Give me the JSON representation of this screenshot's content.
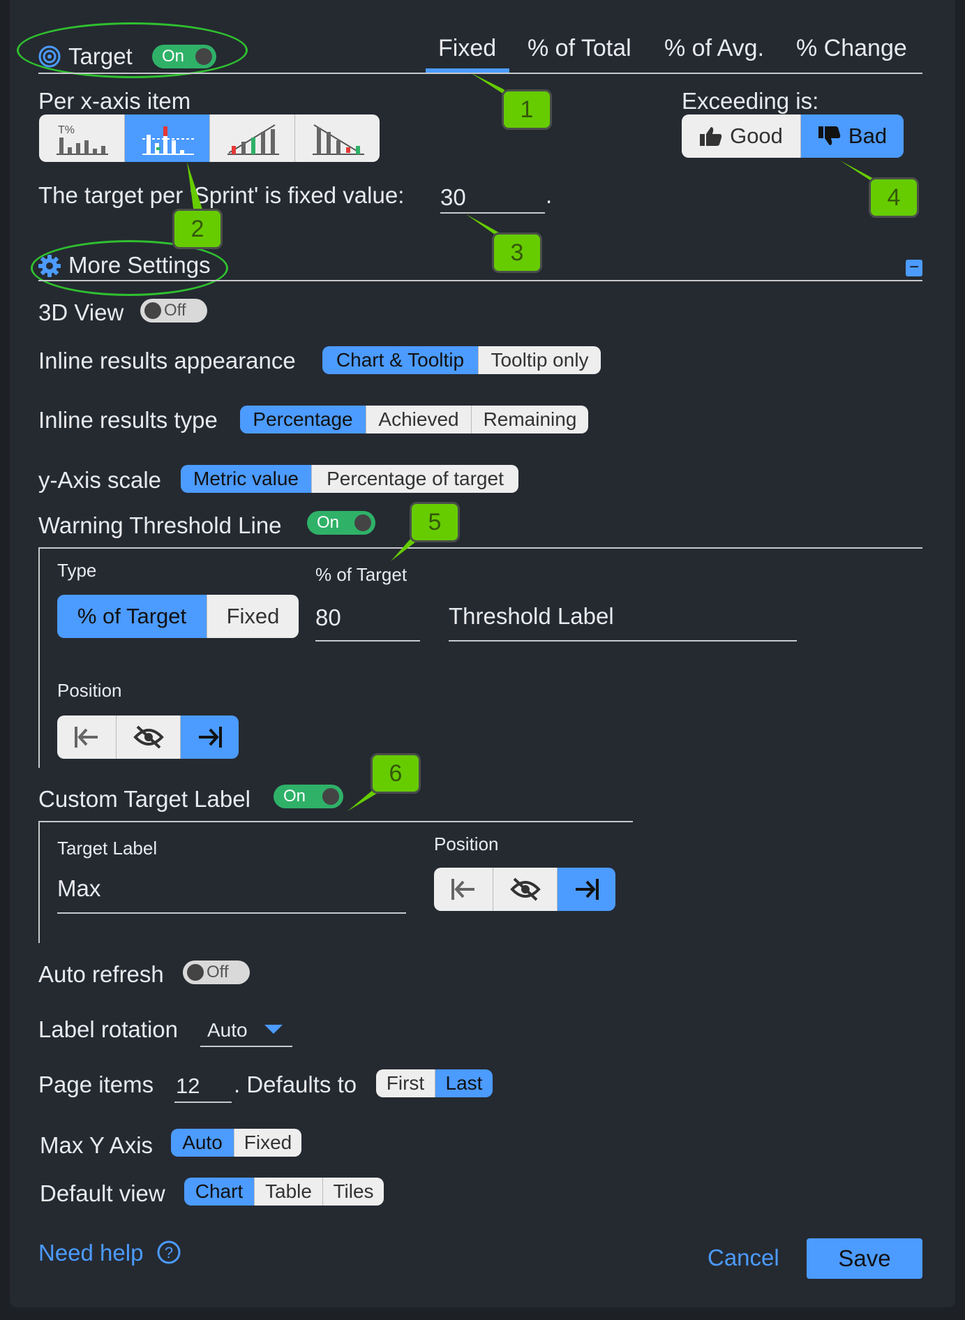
{
  "target": {
    "label": "Target",
    "toggle": "On",
    "tabs": [
      "Fixed",
      "% of Total",
      "% of Avg.",
      "% Change"
    ],
    "active_tab": "Fixed"
  },
  "per_item": {
    "label": "Per x-axis item"
  },
  "exceeding": {
    "label": "Exceeding is:",
    "good": "Good",
    "bad": "Bad",
    "selected": "Bad"
  },
  "target_sentence": {
    "text": "The target per 'Sprint' is fixed value:",
    "value": "30",
    "suffix": "."
  },
  "more_settings": {
    "label": "More Settings",
    "collapse": "−"
  },
  "view3d": {
    "label": "3D View",
    "toggle": "Off"
  },
  "inline_appearance": {
    "label": "Inline results appearance",
    "options": [
      "Chart & Tooltip",
      "Tooltip only"
    ],
    "selected": "Chart & Tooltip"
  },
  "inline_type": {
    "label": "Inline results type",
    "options": [
      "Percentage",
      "Achieved",
      "Remaining"
    ],
    "selected": "Percentage"
  },
  "y_scale": {
    "label": "y-Axis scale",
    "options": [
      "Metric value",
      "Percentage of target"
    ],
    "selected": "Metric value"
  },
  "warning": {
    "label": "Warning Threshold Line",
    "toggle": "On",
    "type_label": "Type",
    "type_options": [
      "% of Target",
      "Fixed"
    ],
    "type_selected": "% of Target",
    "pct_label": "% of Target",
    "pct_value": "80",
    "threshold_placeholder": "Threshold Label",
    "position_label": "Position"
  },
  "custom_label": {
    "label": "Custom Target Label",
    "toggle": "On",
    "target_label_caption": "Target Label",
    "target_label_value": "Max",
    "position_label": "Position"
  },
  "auto_refresh": {
    "label": "Auto refresh",
    "toggle": "Off"
  },
  "label_rotation": {
    "label": "Label rotation",
    "value": "Auto"
  },
  "page_items": {
    "label": "Page items",
    "value": "12",
    "defaults_label": ". Defaults to",
    "options": [
      "First",
      "Last"
    ],
    "selected": "Last"
  },
  "max_y": {
    "label": "Max Y Axis",
    "options": [
      "Auto",
      "Fixed"
    ],
    "selected": "Auto"
  },
  "default_view": {
    "label": "Default view",
    "options": [
      "Chart",
      "Table",
      "Tiles"
    ],
    "selected": "Chart"
  },
  "footer": {
    "help": "Need help",
    "cancel": "Cancel",
    "save": "Save"
  },
  "callouts": [
    "1",
    "2",
    "3",
    "4",
    "5",
    "6"
  ],
  "colors": {
    "accent": "#4c9bff",
    "toggle_on": "#2fb168",
    "callout": "#66cc00",
    "background": "#252a31"
  }
}
